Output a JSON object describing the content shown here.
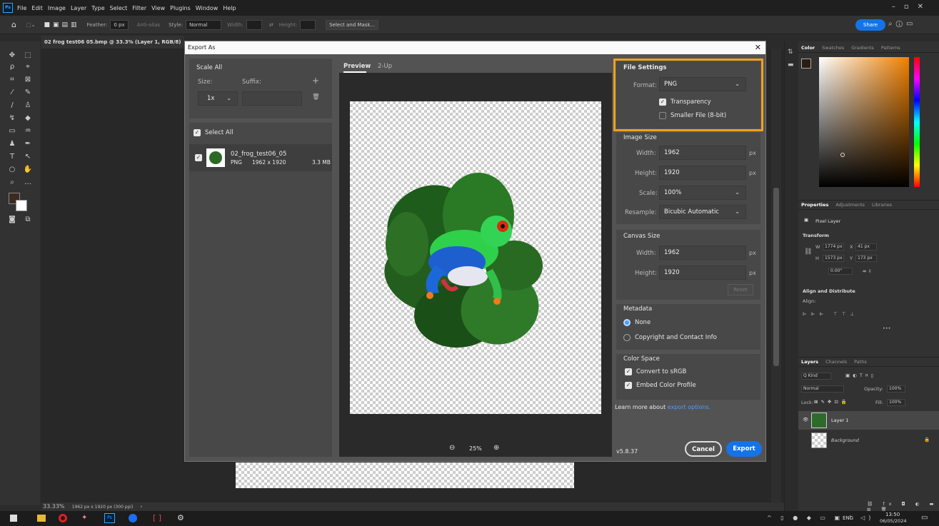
{
  "menu": {
    "app_badge": "Ps",
    "items": [
      "File",
      "Edit",
      "Image",
      "Layer",
      "Type",
      "Select",
      "Filter",
      "View",
      "Plugins",
      "Window",
      "Help"
    ]
  },
  "options_bar": {
    "feather_label": "Feather:",
    "feather_value": "0 px",
    "antialias": "Anti-alias",
    "style_label": "Style:",
    "style_value": "Normal",
    "width_label": "Width:",
    "height_label": "Height:",
    "select_mask": "Select and Mask...",
    "share": "Share"
  },
  "document": {
    "tab_title": "02 frog test06 05.bmp @ 33.3% (Layer 1, RGB/8) *",
    "zoom": "33.33%",
    "info": "1962 px x 1920 px (300 ppi)"
  },
  "dialog": {
    "title": "Export As",
    "scale_all": "Scale All",
    "size_label": "Size:",
    "suffix_label": "Suffix:",
    "size_value": "1x",
    "select_all": "Select All",
    "asset": {
      "name": "02_frog_test06_05",
      "format": "PNG",
      "dims": "1962 x 1920",
      "filesize": "3.3 MB"
    },
    "tabs": {
      "preview": "Preview",
      "twoup": "2-Up"
    },
    "zoom_value": "25%",
    "file_settings": {
      "title": "File Settings",
      "format_label": "Format:",
      "format_value": "PNG",
      "transparency": "Transparency",
      "smaller_file": "Smaller File (8-bit)",
      "transparency_checked": true,
      "smaller_checked": false
    },
    "image_size": {
      "title": "Image Size",
      "width_label": "Width:",
      "width_value": "1962",
      "height_label": "Height:",
      "height_value": "1920",
      "unit": "px",
      "scale_label": "Scale:",
      "scale_value": "100%",
      "resample_label": "Resample:",
      "resample_value": "Bicubic Automatic"
    },
    "canvas_size": {
      "title": "Canvas Size",
      "width_label": "Width:",
      "width_value": "1962",
      "height_label": "Height:",
      "height_value": "1920",
      "unit": "px",
      "reset": "Reset"
    },
    "metadata": {
      "title": "Metadata",
      "none": "None",
      "copyright": "Copyright and Contact Info",
      "selected": "None"
    },
    "color_space": {
      "title": "Color Space",
      "convert": "Convert to sRGB",
      "embed": "Embed Color Profile"
    },
    "learn_more": "Learn more about",
    "learn_link": "export options.",
    "version": "v5.8.37",
    "cancel": "Cancel",
    "export": "Export"
  },
  "panels": {
    "color_tabs": [
      "Color",
      "Swatches",
      "Gradients",
      "Patterns"
    ],
    "properties_tabs": [
      "Properties",
      "Adjustments",
      "Libraries"
    ],
    "pixel_layer": "Pixel Layer",
    "transform": "Transform",
    "w": "W",
    "w_value": "1774 px",
    "x": "X",
    "x_value": "41 px",
    "h": "H",
    "h_value": "1573 px",
    "y": "Y",
    "y_value": "173 px",
    "angle_value": "0.00°",
    "align_distribute": "Align and Distribute",
    "align_label": "Align:",
    "layers_tabs": [
      "Layers",
      "Channels",
      "Paths"
    ],
    "kind": "Q Kind",
    "blend_mode": "Normal",
    "opacity_label": "Opacity:",
    "opacity_value": "100%",
    "lock_label": "Lock:",
    "fill_label": "Fill:",
    "fill_value": "100%",
    "layers": [
      "Layer 1",
      "Background"
    ]
  },
  "taskbar": {
    "lang": "ENG",
    "time": "13:50",
    "date": "06/05/2024"
  },
  "colors": {
    "accent": "#1473e6",
    "highlight": "#f0a11a",
    "link": "#4a9fff"
  }
}
